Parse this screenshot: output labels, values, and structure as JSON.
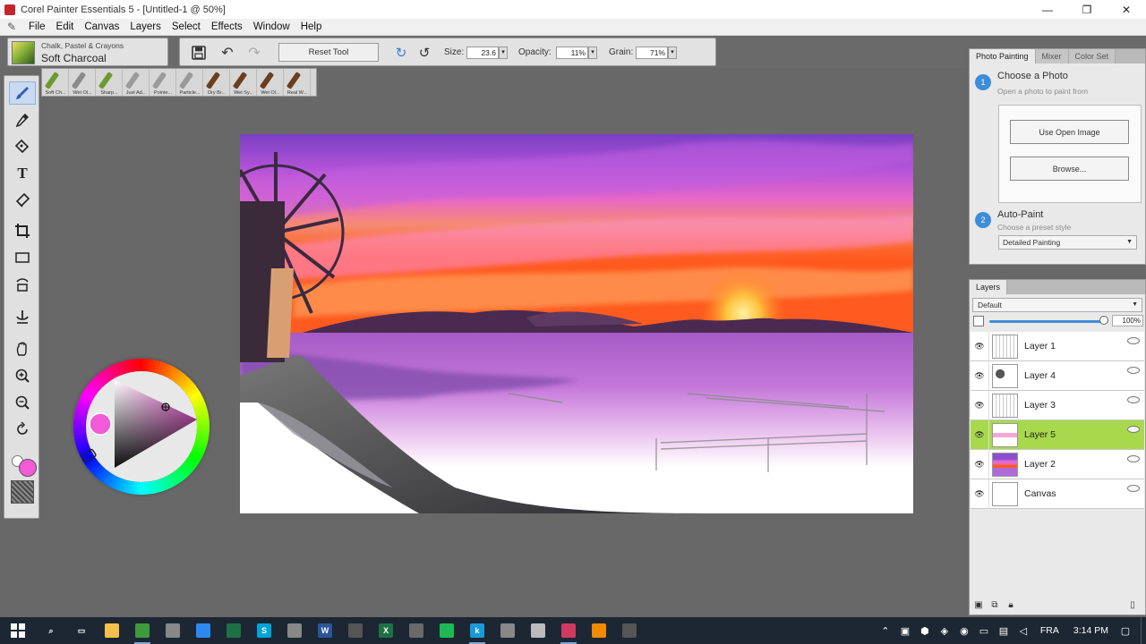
{
  "window": {
    "title": "Corel Painter Essentials 5 - [Untitled-1 @ 50%]",
    "controls": {
      "minimize": "—",
      "restore": "❐",
      "close": "✕"
    }
  },
  "menu": [
    "File",
    "Edit",
    "Canvas",
    "Layers",
    "Select",
    "Effects",
    "Window",
    "Help"
  ],
  "property_bar": {
    "brush_category": "Chalk, Pastel & Crayons",
    "brush_variant": "Soft Charcoal",
    "reset_tool_label": "Reset Tool",
    "size_label": "Size:",
    "size_value": "23.6",
    "opacity_label": "Opacity:",
    "opacity_value": "11%",
    "grain_label": "Grain:",
    "grain_value": "71%",
    "icons": [
      "save-icon",
      "undo-icon",
      "redo-icon",
      "stylus-icon",
      "stylus-alt-icon"
    ]
  },
  "recent_brushes": [
    {
      "label": "Soft Ch...",
      "color": "#6d9a2e"
    },
    {
      "label": "Wet Ol...",
      "color": "#8a8a8a"
    },
    {
      "label": "Sharp...",
      "color": "#6d9a2e"
    },
    {
      "label": "Just Ad...",
      "color": "#9a9a9a"
    },
    {
      "label": "Pointe...",
      "color": "#9a9a9a"
    },
    {
      "label": "Particle...",
      "color": "#9a9a9a"
    },
    {
      "label": "Dry Br...",
      "color": "#6b3e1f"
    },
    {
      "label": "Wet Sy...",
      "color": "#6b3e1f"
    },
    {
      "label": "Wet Ol...",
      "color": "#6b3e1f"
    },
    {
      "label": "Real W...",
      "color": "#6b3e1f"
    }
  ],
  "toolbox": {
    "tools": [
      "brush-icon",
      "dropper-icon",
      "paint-bucket-icon",
      "text-icon",
      "eraser-icon",
      "crop-icon",
      "rect-select-icon",
      "transform-icon",
      "clone-icon",
      "grabber-icon",
      "zoom-in-icon",
      "zoom-out-icon",
      "rotate-icon"
    ],
    "main_color": "#f25ad8",
    "wheel_hue_color": "#f25ad8"
  },
  "photo_painting": {
    "tabs": [
      "Photo Painting",
      "Mixer",
      "Color Set"
    ],
    "step1_number": "1",
    "step1_title": "Choose a Photo",
    "step1_sub": "Open a photo to paint from",
    "use_open_image": "Use Open Image",
    "browse": "Browse...",
    "step2_number": "2",
    "step2_title": "Auto-Paint",
    "step2_sub": "Choose a preset style",
    "preset": "Detailed Painting"
  },
  "layers": {
    "tab": "Layers",
    "composite": "Default",
    "opacity": "100%",
    "items": [
      {
        "name": "Layer 1",
        "selected": false,
        "thumb": "sketch"
      },
      {
        "name": "Layer 4",
        "selected": false,
        "thumb": "wheel"
      },
      {
        "name": "Layer 3",
        "selected": false,
        "thumb": "sketch"
      },
      {
        "name": "Layer 5",
        "selected": true,
        "thumb": "pink"
      },
      {
        "name": "Layer 2",
        "selected": false,
        "thumb": "sunset"
      },
      {
        "name": "Canvas",
        "selected": false,
        "thumb": "blank"
      }
    ]
  },
  "taskbar": {
    "apps": [
      {
        "name": "search",
        "glyph": "⌕",
        "color": "transparent"
      },
      {
        "name": "task-view",
        "glyph": "▭",
        "color": "transparent"
      },
      {
        "name": "file-explorer",
        "glyph": "",
        "color": "#f2c04b"
      },
      {
        "name": "chrome",
        "glyph": "",
        "color": "#3f9a3a"
      },
      {
        "name": "store",
        "glyph": "",
        "color": "#888888"
      },
      {
        "name": "app-a",
        "glyph": "",
        "color": "#2d89ef"
      },
      {
        "name": "excel-green",
        "glyph": "",
        "color": "#1e7145"
      },
      {
        "name": "app-s",
        "glyph": "S",
        "color": "#00a4d8"
      },
      {
        "name": "app-p",
        "glyph": "",
        "color": "#888888"
      },
      {
        "name": "word",
        "glyph": "W",
        "color": "#2b5797"
      },
      {
        "name": "app-clap",
        "glyph": "",
        "color": "#555555"
      },
      {
        "name": "excel",
        "glyph": "X",
        "color": "#1e7145"
      },
      {
        "name": "app-w",
        "glyph": "",
        "color": "#6a6a6a"
      },
      {
        "name": "spotify",
        "glyph": "",
        "color": "#1db954"
      },
      {
        "name": "app-k",
        "glyph": "k",
        "color": "#1a9bd8"
      },
      {
        "name": "app-link",
        "glyph": "",
        "color": "#888888"
      },
      {
        "name": "app-disc",
        "glyph": "",
        "color": "#bbbbbb"
      },
      {
        "name": "corel-painter",
        "glyph": "",
        "color": "#d13a60"
      },
      {
        "name": "vlc",
        "glyph": "",
        "color": "#f08a00"
      },
      {
        "name": "app-y",
        "glyph": "",
        "color": "#555555"
      }
    ],
    "language": "FRA",
    "time": "3:14 PM"
  }
}
